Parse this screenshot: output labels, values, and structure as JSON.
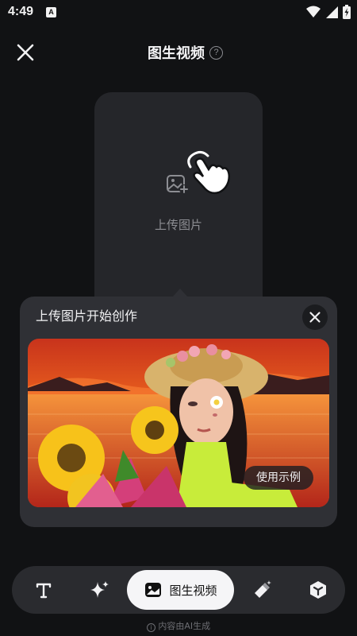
{
  "status": {
    "time": "4:49",
    "app_badge": "A"
  },
  "header": {
    "title": "图生视频",
    "help_glyph": "?"
  },
  "upload": {
    "label": "上传图片"
  },
  "tip": {
    "title": "上传图片开始创作",
    "example_tag": "使用示例"
  },
  "toolbar": {
    "items": [
      {
        "icon": "text-icon",
        "label": ""
      },
      {
        "icon": "sparkle-icon",
        "label": ""
      },
      {
        "icon": "image-icon",
        "label": "图生视频"
      },
      {
        "icon": "eraser-icon",
        "label": ""
      },
      {
        "icon": "cube-icon",
        "label": ""
      }
    ]
  },
  "footer_note": "内容由AI生成",
  "colors": {
    "background": "#111214",
    "card": "#25262a",
    "popover": "#2f3035",
    "active_tool": "#f5f5f7"
  }
}
